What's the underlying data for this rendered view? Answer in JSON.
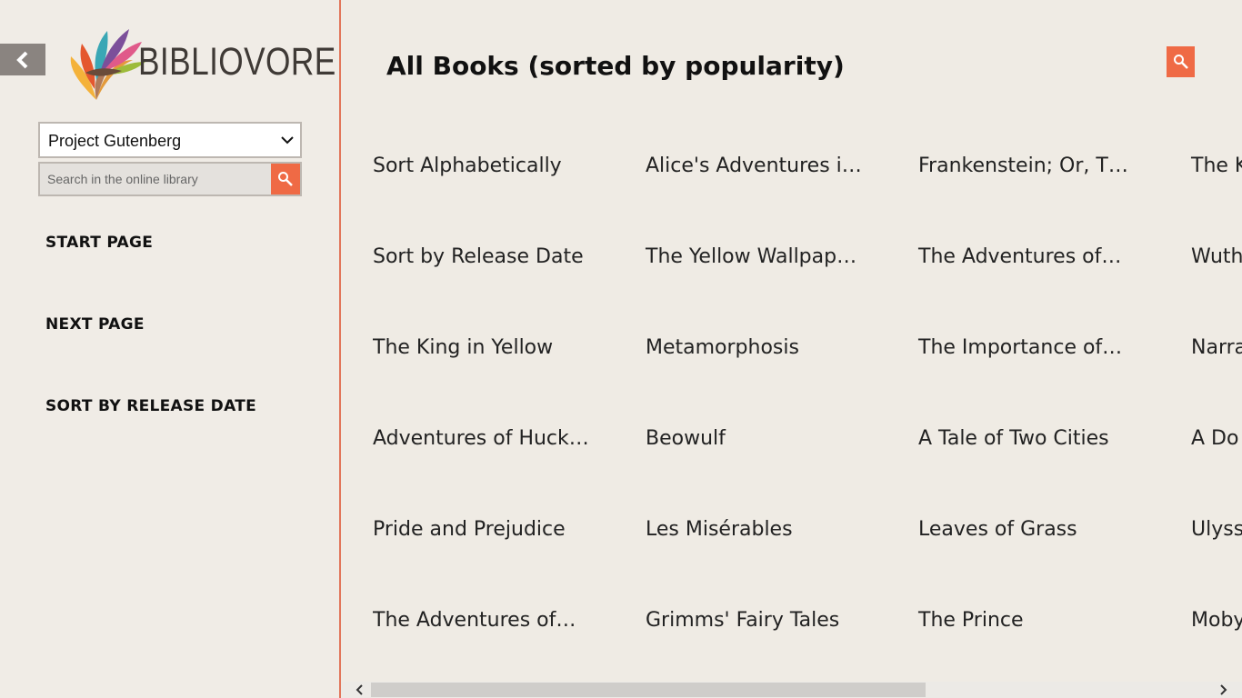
{
  "app": {
    "logo_text": "BIBLIOVORE"
  },
  "sidebar": {
    "library_select": {
      "value": "Project Gutenberg"
    },
    "search": {
      "placeholder": "Search in the online library"
    },
    "nav": [
      {
        "label": "START PAGE"
      },
      {
        "label": "NEXT PAGE"
      },
      {
        "label": "SORT BY RELEASE DATE"
      }
    ]
  },
  "main": {
    "title": "All Books (sorted by popularity)",
    "columns": [
      [
        "Sort Alphabetically",
        "Sort by Release Date",
        "The King in Yellow",
        "Adventures of Huck…",
        "Pride and Prejudice",
        "The Adventures of…"
      ],
      [
        "Alice's Adventures i…",
        "The Yellow Wallpap…",
        "Metamorphosis",
        "Beowulf",
        "Les Misérables",
        "Grimms' Fairy Tales"
      ],
      [
        "Frankenstein; Or, T…",
        "The Adventures of…",
        "The Importance of…",
        "A Tale of Two Cities",
        "Leaves of Grass",
        "The Prince"
      ],
      [
        "The K",
        "Wuth",
        "Narra",
        "A Do",
        "Ulyss",
        "Moby"
      ]
    ]
  },
  "colors": {
    "accent": "#ef6a45",
    "divider": "#e2765a",
    "back_button": "#8a8480"
  },
  "icons": {
    "back": "chevron-left-icon",
    "search": "search-icon",
    "dropdown": "chevron-down-icon"
  }
}
